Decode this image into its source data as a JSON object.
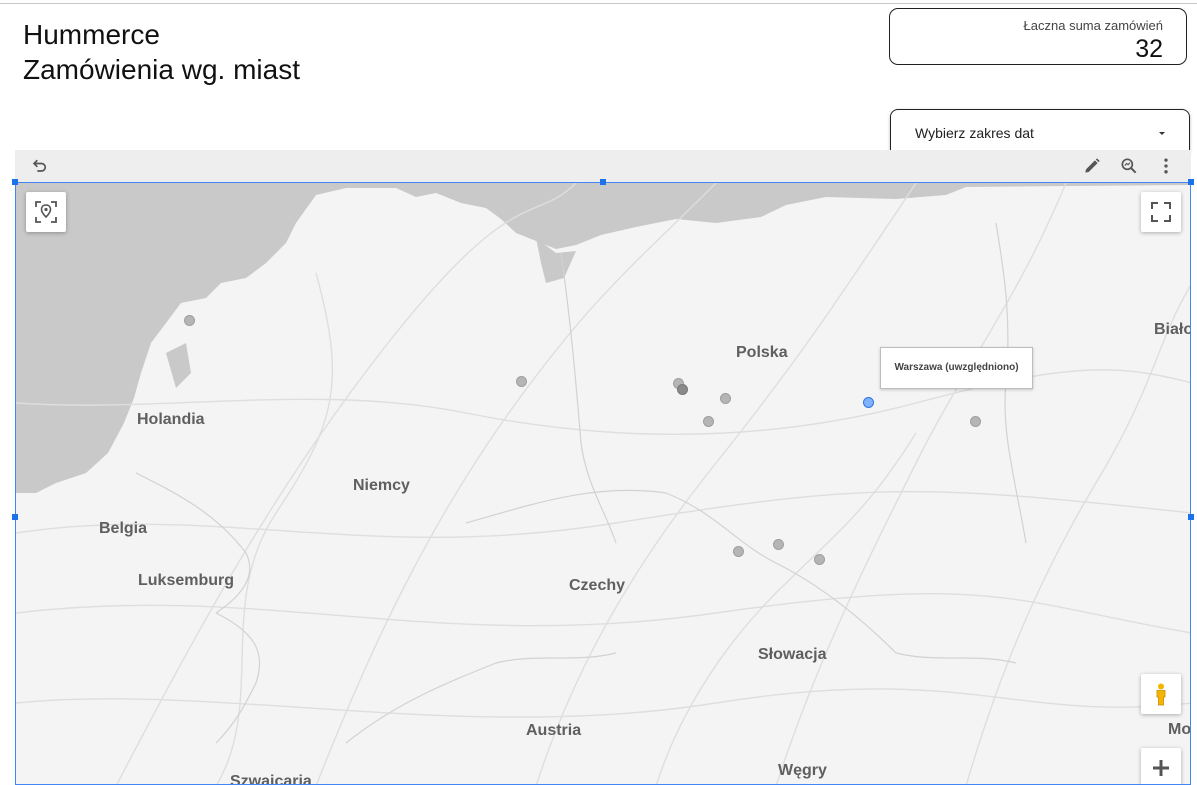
{
  "header": {
    "title_line1": "Hummerce",
    "title_line2": "Zamówienia wg. miast"
  },
  "kpi": {
    "label": "Łaczna suma zamówień",
    "value": "32"
  },
  "date_filter": {
    "label": "Wybierz zakres dat"
  },
  "toolbar": {
    "icons": [
      "undo-icon",
      "edit-icon",
      "explore-icon",
      "more-vert-icon"
    ]
  },
  "map": {
    "labels": {
      "polska": "Polska",
      "holandia": "Holandia",
      "niemcy": "Niemcy",
      "belgia": "Belgia",
      "luksemburg": "Luksemburg",
      "czechy": "Czechy",
      "slowacja": "Słowacja",
      "austria": "Austria",
      "wegry": "Węgry",
      "szwajcaria": "Szwajcaria",
      "bialorus_partial": "Biało",
      "moldawia_partial": "Mo"
    },
    "tooltip": "Warszawa (uwzględniono)",
    "controls": [
      "locate-icon",
      "fullscreen-icon",
      "pegman-icon",
      "zoom-in-icon"
    ],
    "colors": {
      "water": "#c9c9c9",
      "land": "#f4f4f4",
      "marker": "#b5b5b5",
      "selected_marker": "#7fb2ff"
    }
  }
}
